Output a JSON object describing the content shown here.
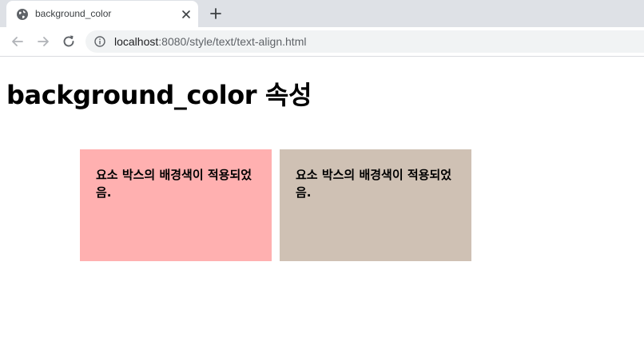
{
  "tab": {
    "title": "background_color"
  },
  "address_bar": {
    "host": "localhost",
    "path": ":8080/style/text/text-align.html"
  },
  "page": {
    "heading": "background_color 속성",
    "boxes": [
      {
        "text": "요소 박스의 배경색이 적용되었음.",
        "color": "#ffb0b0"
      },
      {
        "text": "요소 박스의 배경색이 적용되었음.",
        "color": "#cfc1b4"
      }
    ]
  },
  "icons": {
    "favicon": "globe-icon",
    "tab_close": "close-icon",
    "new_tab": "plus-icon",
    "back": "back-arrow-icon",
    "forward": "forward-arrow-icon",
    "reload": "reload-icon",
    "site_info": "info-icon"
  },
  "colors": {
    "tabstrip": "#dee1e6",
    "omnibox": "#f1f3f4"
  }
}
